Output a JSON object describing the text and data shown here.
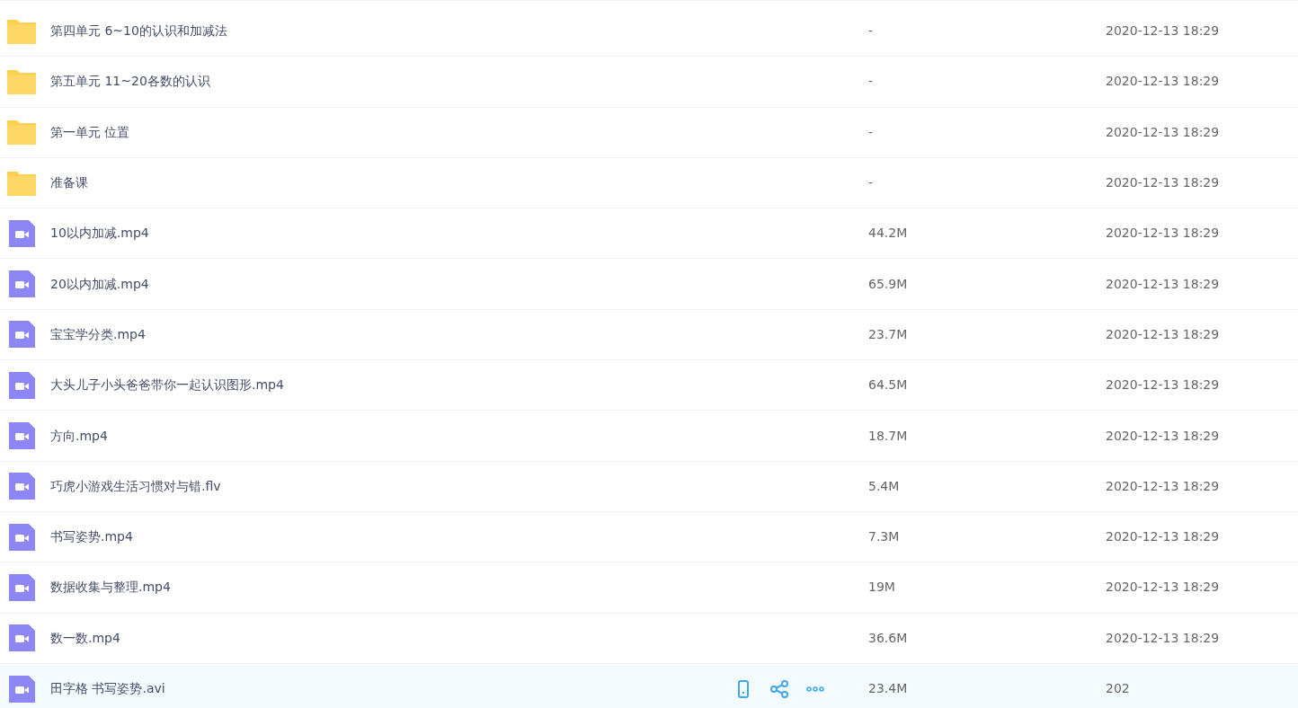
{
  "files": [
    {
      "kind": "folder",
      "name": "第四单元 6~10的认识和加减法",
      "size": "-",
      "date": "2020-12-13 18:29",
      "hovered": false
    },
    {
      "kind": "folder",
      "name": "第五单元 11~20各数的认识",
      "size": "-",
      "date": "2020-12-13 18:29",
      "hovered": false
    },
    {
      "kind": "folder",
      "name": "第一单元 位置",
      "size": "-",
      "date": "2020-12-13 18:29",
      "hovered": false
    },
    {
      "kind": "folder",
      "name": "准备课",
      "size": "-",
      "date": "2020-12-13 18:29",
      "hovered": false
    },
    {
      "kind": "video",
      "name": "10以内加减.mp4",
      "size": "44.2M",
      "date": "2020-12-13 18:29",
      "hovered": false
    },
    {
      "kind": "video",
      "name": "20以内加减.mp4",
      "size": "65.9M",
      "date": "2020-12-13 18:29",
      "hovered": false
    },
    {
      "kind": "video",
      "name": "宝宝学分类.mp4",
      "size": "23.7M",
      "date": "2020-12-13 18:29",
      "hovered": false
    },
    {
      "kind": "video",
      "name": "大头儿子小头爸爸带你一起认识图形.mp4",
      "size": "64.5M",
      "date": "2020-12-13 18:29",
      "hovered": false
    },
    {
      "kind": "video",
      "name": "方向.mp4",
      "size": "18.7M",
      "date": "2020-12-13 18:29",
      "hovered": false
    },
    {
      "kind": "video",
      "name": "巧虎小游戏生活习惯对与错.flv",
      "size": "5.4M",
      "date": "2020-12-13 18:29",
      "hovered": false
    },
    {
      "kind": "video",
      "name": "书写姿势.mp4",
      "size": "7.3M",
      "date": "2020-12-13 18:29",
      "hovered": false
    },
    {
      "kind": "video",
      "name": "数据收集与整理.mp4",
      "size": "19M",
      "date": "2020-12-13 18:29",
      "hovered": false
    },
    {
      "kind": "video",
      "name": "数一数.mp4",
      "size": "36.6M",
      "date": "2020-12-13 18:29",
      "hovered": false
    },
    {
      "kind": "video",
      "name": "田字格 书写姿势.avi",
      "size": "23.4M",
      "date": "202",
      "hovered": true
    }
  ]
}
